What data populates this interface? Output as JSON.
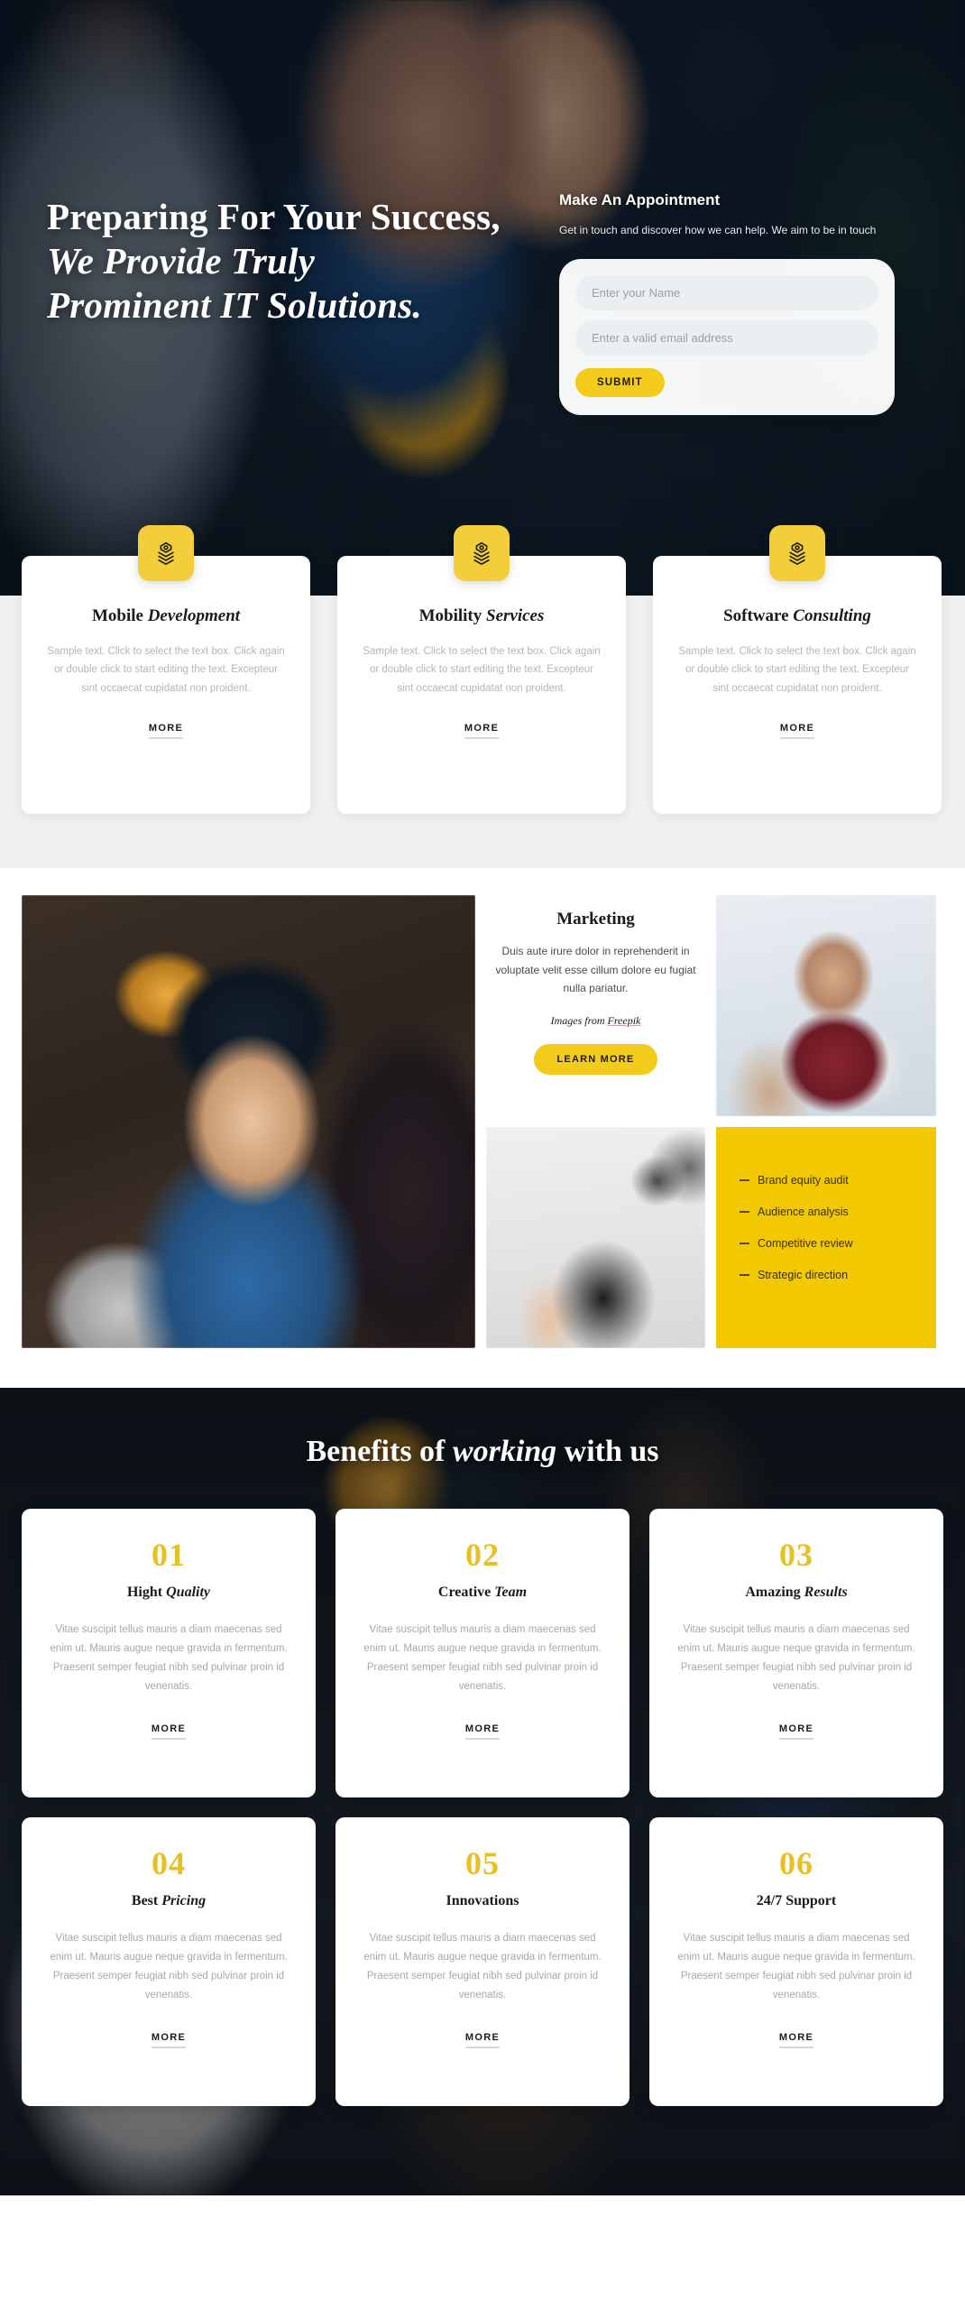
{
  "hero": {
    "title_line1": "Preparing For Your",
    "title_line2": "Success,",
    "title_line3": "We Provide Truly",
    "title_line4": "Prominent IT Solutions.",
    "form_heading": "Make An Appointment",
    "form_sub": "Get in touch and discover how we can help. We aim to be in touch",
    "name_placeholder": "Enter your Name",
    "email_placeholder": "Enter a valid email address",
    "name_value": "",
    "email_value": "",
    "submit_label": "SUBMIT"
  },
  "services": {
    "more_label": "MORE",
    "icon_name": "layers-stack-icon",
    "cards": [
      {
        "title_bold": "Mobile",
        "title_italic": "Development",
        "text": "Sample text. Click to select the text box. Click again or double click to start editing the text. Excepteur sint occaecat cupidatat non proident."
      },
      {
        "title_bold": "Mobility",
        "title_italic": "Services",
        "text": "Sample text. Click to select the text box. Click again or double click to start editing the text. Excepteur sint occaecat cupidatat non proident."
      },
      {
        "title_bold": "Software",
        "title_italic": "Consulting",
        "text": "Sample text. Click to select the text box. Click again or double click to start editing the text. Excepteur sint occaecat cupidatat non proident."
      }
    ]
  },
  "marketing": {
    "title": "Marketing",
    "text": "Duis aute irure dolor in reprehenderit in voluptate velit esse cillum dolore eu fugiat nulla pariatur.",
    "credit_prefix": "Images from ",
    "credit_link": "Freepik",
    "button_label": "LEARN MORE",
    "list": [
      "Brand equity audit",
      "Audience analysis",
      "Competitive review",
      "Strategic direction"
    ],
    "images": {
      "big": "team-collaboration-photo",
      "tall": "smiling-man-handshake-photo",
      "desk": "desk-flatlay-phone-photo"
    }
  },
  "benefits": {
    "heading_part1": "Benefits of ",
    "heading_italic": "working",
    "heading_part2": " with us",
    "more_label": "MORE",
    "cards": [
      {
        "num": "01",
        "title_bold": "Hight",
        "title_italic": "Quality",
        "text": "Vitae suscipit tellus mauris a diam maecenas sed enim ut. Mauris augue neque gravida in fermentum. Praesent semper feugiat nibh sed pulvinar proin id venenatis."
      },
      {
        "num": "02",
        "title_bold": "Creative",
        "title_italic": "Team",
        "text": "Vitae suscipit tellus mauris a diam maecenas sed enim ut. Mauris augue neque gravida in fermentum. Praesent semper feugiat nibh sed pulvinar proin id venenatis."
      },
      {
        "num": "03",
        "title_bold": "Amazing",
        "title_italic": "Results",
        "text": "Vitae suscipit tellus mauris a diam maecenas sed enim ut. Mauris augue neque gravida in fermentum. Praesent semper feugiat nibh sed pulvinar proin id venenatis."
      },
      {
        "num": "04",
        "title_bold": "Best",
        "title_italic": "Pricing",
        "text": "Vitae suscipit tellus mauris a diam maecenas sed enim ut. Mauris augue neque gravida in fermentum. Praesent semper feugiat nibh sed pulvinar proin id venenatis."
      },
      {
        "num": "05",
        "title_bold": "Innovations",
        "title_italic": "",
        "text": "Vitae suscipit tellus mauris a diam maecenas sed enim ut. Mauris augue neque gravida in fermentum. Praesent semper feugiat nibh sed pulvinar proin id venenatis."
      },
      {
        "num": "06",
        "title_bold": "24/7 Support",
        "title_italic": "",
        "text": "Vitae suscipit tellus mauris a diam maecenas sed enim ut. Mauris augue neque gravida in fermentum. Praesent semper feugiat nibh sed pulvinar proin id venenatis."
      }
    ]
  },
  "colors": {
    "accent_yellow": "#f2cb1d",
    "list_block_yellow": "#f2c900",
    "number_gold": "#e8bf25",
    "section_gray": "#f0f0f0",
    "text_dark": "#1b1b1b",
    "text_muted": "#b5b5b5"
  }
}
